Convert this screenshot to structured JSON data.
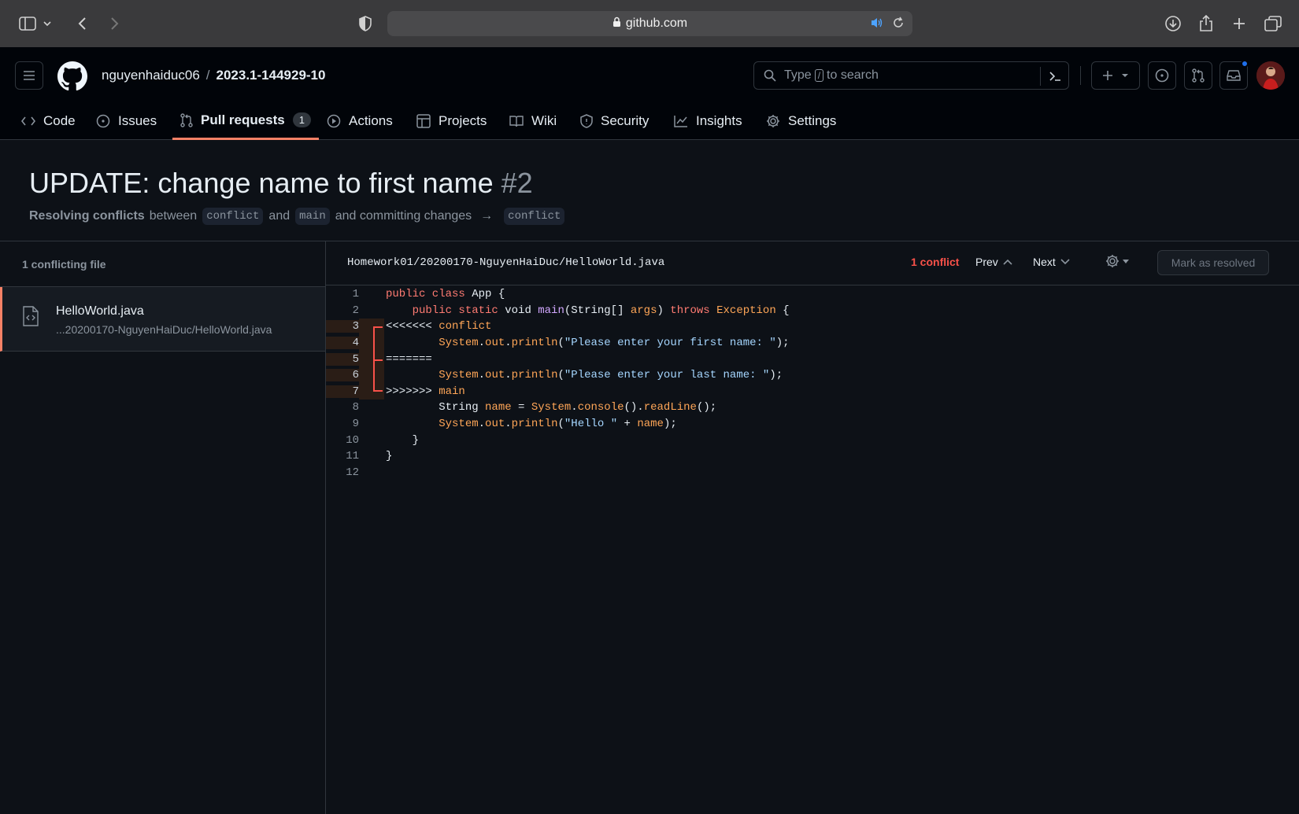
{
  "browser": {
    "url": "github.com"
  },
  "header": {
    "owner": "nguyenhaiduc06",
    "separator": "/",
    "repo": "2023.1-144929-10",
    "search_prefix": "Type",
    "search_key": "/",
    "search_suffix": "to search"
  },
  "tabs": [
    {
      "label": "Code",
      "icon": "code-icon"
    },
    {
      "label": "Issues",
      "icon": "issue-icon"
    },
    {
      "label": "Pull requests",
      "icon": "pull-request-icon",
      "count": "1",
      "active": true
    },
    {
      "label": "Actions",
      "icon": "play-icon"
    },
    {
      "label": "Projects",
      "icon": "table-icon"
    },
    {
      "label": "Wiki",
      "icon": "book-icon"
    },
    {
      "label": "Security",
      "icon": "shield-icon"
    },
    {
      "label": "Insights",
      "icon": "graph-icon"
    },
    {
      "label": "Settings",
      "icon": "gear-icon"
    }
  ],
  "pr": {
    "title": "UPDATE: change name to first name",
    "number": "#2",
    "sub_strong": "Resolving conflicts",
    "sub_between": "between",
    "head_branch": "conflict",
    "sub_and": "and",
    "base_branch": "main",
    "sub_committing": "and committing changes",
    "arrow": "→",
    "target_branch": "conflict"
  },
  "sidebar": {
    "heading": "1 conflicting file",
    "file_name": "HelloWorld.java",
    "file_path": "...20200170-NguyenHaiDuc/HelloWorld.java"
  },
  "editor": {
    "path": "Homework01/20200170-NguyenHaiDuc/HelloWorld.java",
    "conflict_count": "1 conflict",
    "prev_label": "Prev",
    "next_label": "Next",
    "resolve_label": "Mark as resolved",
    "colors": {
      "conflict_accent": "#f85149",
      "keyword": "#ff7b72",
      "type": "#ffa657",
      "string": "#a5d6ff"
    }
  },
  "code": {
    "lines": [
      {
        "n": "1",
        "parts": [
          {
            "t": "public class ",
            "c": "kw"
          },
          {
            "t": "App {",
            "c": ""
          }
        ]
      },
      {
        "n": "2",
        "parts": [
          {
            "t": "    public static ",
            "c": "kw"
          },
          {
            "t": "void ",
            "c": ""
          },
          {
            "t": "main",
            "c": "fn"
          },
          {
            "t": "(String[] ",
            "c": ""
          },
          {
            "t": "args",
            "c": "id"
          },
          {
            "t": ") ",
            "c": ""
          },
          {
            "t": "throws ",
            "c": "kw"
          },
          {
            "t": "Exception",
            "c": "ty"
          },
          {
            "t": " {",
            "c": ""
          }
        ]
      },
      {
        "n": "3",
        "conflict": "top",
        "parts": [
          {
            "t": "<<<<<<< ",
            "c": "mk"
          },
          {
            "t": "conflict",
            "c": "ty"
          }
        ]
      },
      {
        "n": "4",
        "conflict": "body",
        "parts": [
          {
            "t": "        ",
            "c": ""
          },
          {
            "t": "System",
            "c": "ty"
          },
          {
            "t": ".",
            "c": ""
          },
          {
            "t": "out",
            "c": "id"
          },
          {
            "t": ".",
            "c": ""
          },
          {
            "t": "println",
            "c": "ty"
          },
          {
            "t": "(",
            "c": ""
          },
          {
            "t": "\"Please enter your first name: \"",
            "c": "str"
          },
          {
            "t": ");",
            "c": ""
          }
        ]
      },
      {
        "n": "5",
        "conflict": "mid",
        "parts": [
          {
            "t": "=======",
            "c": "mk"
          }
        ]
      },
      {
        "n": "6",
        "conflict": "body",
        "parts": [
          {
            "t": "        ",
            "c": ""
          },
          {
            "t": "System",
            "c": "ty"
          },
          {
            "t": ".",
            "c": ""
          },
          {
            "t": "out",
            "c": "id"
          },
          {
            "t": ".",
            "c": ""
          },
          {
            "t": "println",
            "c": "ty"
          },
          {
            "t": "(",
            "c": ""
          },
          {
            "t": "\"Please enter your last name: \"",
            "c": "str"
          },
          {
            "t": ");",
            "c": ""
          }
        ]
      },
      {
        "n": "7",
        "conflict": "bottom",
        "parts": [
          {
            "t": ">>>>>>> ",
            "c": "mk"
          },
          {
            "t": "main",
            "c": "ty"
          }
        ]
      },
      {
        "n": "8",
        "parts": [
          {
            "t": "        String ",
            "c": ""
          },
          {
            "t": "name",
            "c": "id"
          },
          {
            "t": " = ",
            "c": ""
          },
          {
            "t": "System",
            "c": "ty"
          },
          {
            "t": ".",
            "c": ""
          },
          {
            "t": "console",
            "c": "ty"
          },
          {
            "t": "().",
            "c": ""
          },
          {
            "t": "readLine",
            "c": "ty"
          },
          {
            "t": "();",
            "c": ""
          }
        ]
      },
      {
        "n": "9",
        "parts": [
          {
            "t": "        ",
            "c": ""
          },
          {
            "t": "System",
            "c": "ty"
          },
          {
            "t": ".",
            "c": ""
          },
          {
            "t": "out",
            "c": "id"
          },
          {
            "t": ".",
            "c": ""
          },
          {
            "t": "println",
            "c": "ty"
          },
          {
            "t": "(",
            "c": ""
          },
          {
            "t": "\"Hello \"",
            "c": "str"
          },
          {
            "t": " + ",
            "c": ""
          },
          {
            "t": "name",
            "c": "id"
          },
          {
            "t": ");",
            "c": ""
          }
        ]
      },
      {
        "n": "10",
        "parts": [
          {
            "t": "    }",
            "c": ""
          }
        ]
      },
      {
        "n": "11",
        "parts": [
          {
            "t": "}",
            "c": ""
          }
        ]
      },
      {
        "n": "12",
        "parts": [
          {
            "t": "",
            "c": ""
          }
        ]
      }
    ]
  }
}
